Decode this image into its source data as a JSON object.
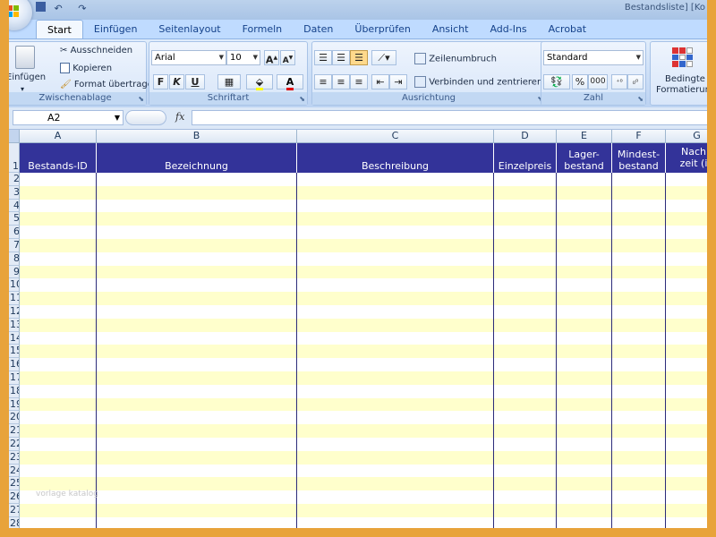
{
  "window": {
    "title": "Bestandsliste] [Ko"
  },
  "tabs": [
    {
      "label": "Start",
      "active": true
    },
    {
      "label": "Einfügen"
    },
    {
      "label": "Seitenlayout"
    },
    {
      "label": "Formeln"
    },
    {
      "label": "Daten"
    },
    {
      "label": "Überprüfen"
    },
    {
      "label": "Ansicht"
    },
    {
      "label": "Add-Ins"
    },
    {
      "label": "Acrobat"
    }
  ],
  "ribbon": {
    "clipboard": {
      "paste_label": "Einfügen",
      "cut_label": "Ausschneiden",
      "copy_label": "Kopieren",
      "format_painter_label": "Format übertragen",
      "group_label": "Zwischenablage"
    },
    "font": {
      "font_name": "Arial",
      "font_size": "10",
      "bold": "F",
      "italic": "K",
      "underline": "U",
      "group_label": "Schriftart"
    },
    "alignment": {
      "wrap_text_label": "Zeilenumbruch",
      "merge_center_label": "Verbinden und zentrieren",
      "group_label": "Ausrichtung"
    },
    "number": {
      "format": "Standard",
      "percent": "%",
      "thousands": "000",
      "group_label": "Zahl"
    },
    "styles": {
      "conditional_label_1": "Bedingte",
      "conditional_label_2": "Formatierung"
    }
  },
  "formula_bar": {
    "name_box": "A2",
    "fx": "fx",
    "formula": ""
  },
  "columns": [
    "A",
    "B",
    "C",
    "D",
    "E",
    "F",
    "G"
  ],
  "headers": [
    "Bestands-ID",
    "Bezeichnung",
    "Beschreibung",
    "Einzelpreis",
    "Lager-\nbestand",
    "Mindest-\nbestand",
    "Nachb\nzeit (in"
  ],
  "rows": [
    "1",
    "2",
    "3",
    "4",
    "5",
    "6",
    "7",
    "8",
    "9",
    "10",
    "11",
    "12",
    "13",
    "14",
    "15",
    "16",
    "17",
    "18",
    "19",
    "20",
    "21",
    "22",
    "23",
    "24",
    "25",
    "26",
    "27",
    "28"
  ],
  "watermark": "vorlage katalog",
  "colors": {
    "header_bg": "#333399",
    "band_yellow": "#ffffcc",
    "frame": "#e8a33a"
  }
}
